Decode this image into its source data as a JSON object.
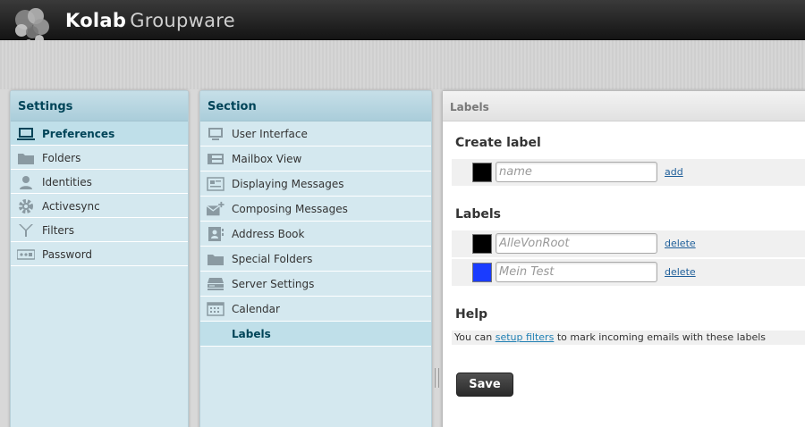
{
  "app": {
    "brand_primary": "Kolab",
    "brand_secondary": "Groupware"
  },
  "settings": {
    "title": "Settings",
    "items": [
      {
        "label": "Preferences",
        "icon": "monitor-icon",
        "selected": true
      },
      {
        "label": "Folders",
        "icon": "folder-icon"
      },
      {
        "label": "Identities",
        "icon": "person-icon"
      },
      {
        "label": "Activesync",
        "icon": "gear-icon"
      },
      {
        "label": "Filters",
        "icon": "filter-icon"
      },
      {
        "label": "Password",
        "icon": "password-icon"
      }
    ]
  },
  "section": {
    "title": "Section",
    "items": [
      {
        "label": "User Interface",
        "icon": "monitor-icon"
      },
      {
        "label": "Mailbox View",
        "icon": "mailbox-view-icon"
      },
      {
        "label": "Displaying Messages",
        "icon": "message-display-icon"
      },
      {
        "label": "Composing Messages",
        "icon": "compose-icon"
      },
      {
        "label": "Address Book",
        "icon": "address-book-icon"
      },
      {
        "label": "Special Folders",
        "icon": "folder-icon"
      },
      {
        "label": "Server Settings",
        "icon": "server-icon"
      },
      {
        "label": "Calendar",
        "icon": "calendar-icon"
      },
      {
        "label": "Labels",
        "icon": "",
        "selected": true
      }
    ]
  },
  "content": {
    "header": "Labels",
    "create_heading": "Create label",
    "create": {
      "placeholder": "name",
      "color": "#000000",
      "add_label": "add"
    },
    "labels_heading": "Labels",
    "labels": [
      {
        "name": "AlleVonRoot",
        "color": "#000000",
        "delete_label": "delete"
      },
      {
        "name": "Mein Test",
        "color": "#1a3cff",
        "delete_label": "delete"
      }
    ],
    "help_heading": "Help",
    "help": {
      "prefix": "You can",
      "link": "setup filters",
      "suffix": "to mark incoming emails with these labels"
    },
    "save_label": "Save"
  }
}
